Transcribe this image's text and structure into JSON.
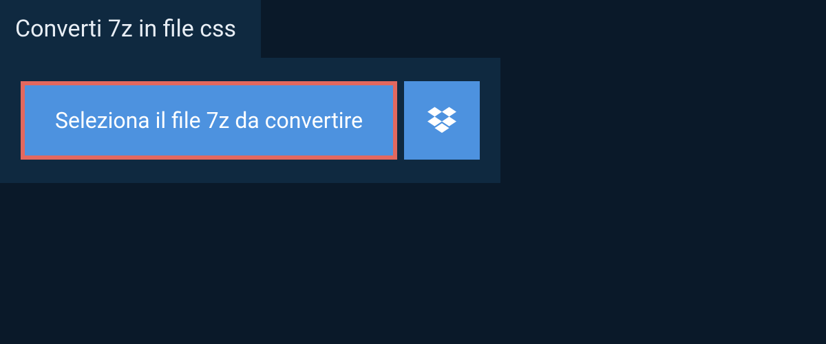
{
  "tab": {
    "title": "Converti 7z in file css"
  },
  "upload": {
    "select_label": "Seleziona il file 7z da convertire"
  }
}
